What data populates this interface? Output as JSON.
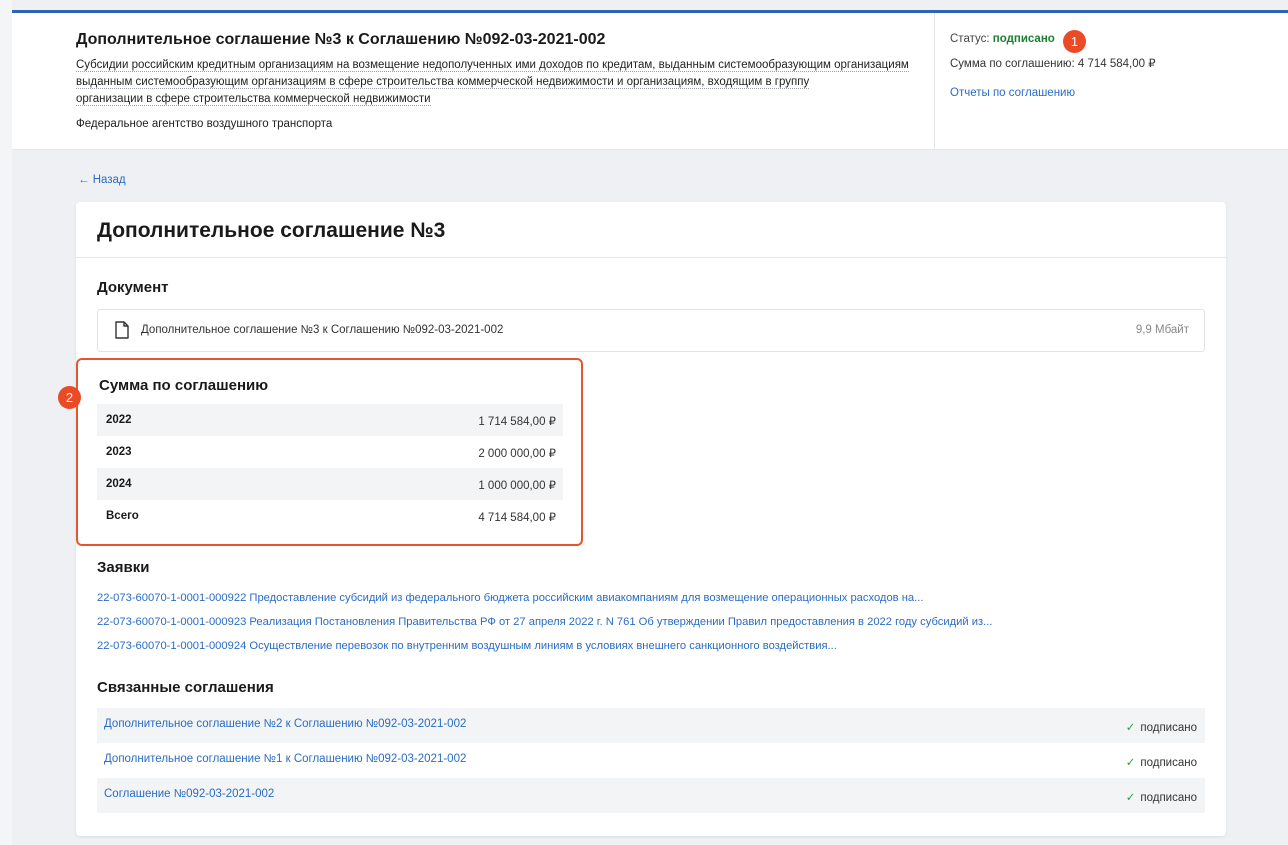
{
  "header": {
    "title": "Дополнительное соглашение №3 к Соглашению №092-03-2021-002",
    "description_lines": [
      "Субсидии российским кредитным организациям на возмещение недополученных ими доходов по кредитам, выданным системообразующим организациям",
      "выданным системообразующим организациям в сфере строительства коммерческой недвижимости и организациям, входящим в группу",
      "организации в сфере строительства коммерческой недвижимости"
    ],
    "agency": "Федеральное агентство воздушного транспорта",
    "status_label": "Статус:",
    "status_value": "подписано",
    "sum_label": "Сумма по соглашению:",
    "sum_value": "4 714 584,00 ₽",
    "reports_link": "Отчеты по соглашению"
  },
  "badges": {
    "first": "1",
    "second": "2"
  },
  "back_link": "← Назад",
  "card": {
    "title": "Дополнительное соглашение №3",
    "document_section": "Документ",
    "document": {
      "name": "Дополнительное соглашение №3 к Соглашению №092-03-2021-002",
      "size": "9,9 Мбайт"
    },
    "sum_section": "Сумма по соглашению",
    "sum_rows": [
      {
        "year": "2022",
        "amount": "1 714 584,00 ₽"
      },
      {
        "year": "2023",
        "amount": "2 000 000,00 ₽"
      },
      {
        "year": "2024",
        "amount": "1 000 000,00 ₽"
      },
      {
        "year": "Всего",
        "amount": "4 714 584,00 ₽"
      }
    ],
    "applications_section": "Заявки",
    "applications": [
      "22-073-60070-1-0001-000922 Предоставление субсидий из федерального бюджета российским авиакомпаниям для возмещение операционных расходов на...",
      "22-073-60070-1-0001-000923 Реализация Постановления Правительства РФ от 27 апреля 2022 г. N 761 Об утверждении Правил предоставления в 2022 году субсидий из...",
      "22-073-60070-1-0001-000924 Осуществление перевозок по внутренним воздушным линиям в условиях внешнего санкционного воздействия..."
    ],
    "related_section": "Связанные соглашения",
    "related": [
      {
        "name": "Дополнительное соглашение №2 к Соглашению №092-03-2021-002",
        "status": "подписано"
      },
      {
        "name": "Дополнительное соглашение №1 к Соглашению №092-03-2021-002",
        "status": "подписано"
      },
      {
        "name": "Соглашение №092-03-2021-002",
        "status": "подписано"
      }
    ]
  },
  "colors": {
    "accent": "#2f63b5",
    "link": "#2a6cc4",
    "status_ok": "#1e7e34",
    "highlight": "#e4562f"
  },
  "icons": {
    "document": "document-icon",
    "check": "check-icon",
    "back": "arrow-left-icon"
  }
}
